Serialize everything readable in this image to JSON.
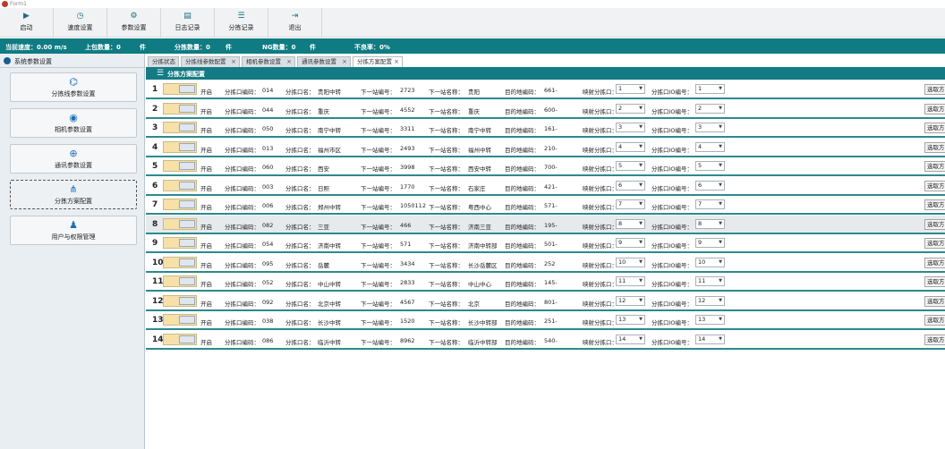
{
  "window": {
    "title": "Form1"
  },
  "toolbar": [
    {
      "label": "启动",
      "icon": "play-icon"
    },
    {
      "label": "速度设置",
      "icon": "speed-icon"
    },
    {
      "label": "参数设置",
      "icon": "settings-icon"
    },
    {
      "label": "日志记录",
      "icon": "printer-icon"
    },
    {
      "label": "分拣记录",
      "icon": "database-icon"
    },
    {
      "label": "退出",
      "icon": "exit-icon"
    }
  ],
  "status": {
    "speed_label": "当前速度：0.00  m/s",
    "upload_label": "上包数量：0",
    "upload_unit": "件",
    "sorted_label": "分拣数量：0",
    "sorted_unit": "件",
    "ng_label": "NG数量：0",
    "ng_unit": "件",
    "reject_label": "不良率：0%"
  },
  "sidebar": {
    "title": "系统参数设置",
    "items": [
      {
        "label": "分拣线参数设置",
        "icon": "network-icon"
      },
      {
        "label": "相机参数设置",
        "icon": "camera-icon"
      },
      {
        "label": "通讯参数设置",
        "icon": "globe-icon"
      },
      {
        "label": "分拣方案配置",
        "icon": "flow-icon"
      },
      {
        "label": "用户与权限管理",
        "icon": "users-icon"
      }
    ]
  },
  "tabs": [
    {
      "label": "分拣状态"
    },
    {
      "label": "分拣线参数配置"
    },
    {
      "label": "相机参数设置"
    },
    {
      "label": "通讯参数设置"
    },
    {
      "label": "分拣方案配置"
    }
  ],
  "panel": {
    "title": "分拣方案配置"
  },
  "row_labels": {
    "switch": "开启",
    "code": "分拣口编码：",
    "name": "分拣口名：",
    "next_code": "下一站编号：",
    "next_name": "下一站名称：",
    "dest": "目的地编码：",
    "map_port": "映射分拣口：",
    "io": "分拣口IO编号：",
    "fetch": "选取方"
  },
  "rows": [
    {
      "n": "1",
      "code": "014",
      "name": "贵阳中转",
      "next_code": "2723",
      "next_name": "贵阳",
      "dest": "661-",
      "map": "1",
      "io": "1"
    },
    {
      "n": "2",
      "code": "044",
      "name": "重庆",
      "next_code": "4552",
      "next_name": "重庆",
      "dest": "600-",
      "map": "2",
      "io": "2"
    },
    {
      "n": "3",
      "code": "050",
      "name": "南宁中转",
      "next_code": "3311",
      "next_name": "南宁中转",
      "dest": "161-",
      "map": "3",
      "io": "3"
    },
    {
      "n": "4",
      "code": "013",
      "name": "福州市区",
      "next_code": "2493",
      "next_name": "福州中转",
      "dest": "210-",
      "map": "4",
      "io": "4"
    },
    {
      "n": "5",
      "code": "060",
      "name": "西安",
      "next_code": "3998",
      "next_name": "西安中转",
      "dest": "700-",
      "map": "5",
      "io": "5"
    },
    {
      "n": "6",
      "code": "003",
      "name": "日照",
      "next_code": "1770",
      "next_name": "石家庄",
      "dest": "421-",
      "map": "6",
      "io": "6"
    },
    {
      "n": "7",
      "code": "006",
      "name": "郑州中转",
      "next_code": "1050112",
      "next_name": "粤西中心",
      "dest": "571-",
      "map": "7",
      "io": "7"
    },
    {
      "n": "8",
      "code": "082",
      "name": "三亚",
      "next_code": "466",
      "next_name": "济南三亚",
      "dest": "195-",
      "map": "8",
      "io": "8"
    },
    {
      "n": "9",
      "code": "054",
      "name": "济南中转",
      "next_code": "571",
      "next_name": "济南中转部",
      "dest": "501-",
      "map": "9",
      "io": "9"
    },
    {
      "n": "10",
      "code": "095",
      "name": "岳麓",
      "next_code": "3434",
      "next_name": "长沙岳麓区",
      "dest": "252",
      "map": "10",
      "io": "10"
    },
    {
      "n": "11",
      "code": "052",
      "name": "中山中转",
      "next_code": "2833",
      "next_name": "中山中心",
      "dest": "145-",
      "map": "11",
      "io": "11"
    },
    {
      "n": "12",
      "code": "092",
      "name": "北京中转",
      "next_code": "4567",
      "next_name": "北京",
      "dest": "801-",
      "map": "12",
      "io": "12"
    },
    {
      "n": "13",
      "code": "038",
      "name": "长沙中转",
      "next_code": "1520",
      "next_name": "长沙中转部",
      "dest": "251-",
      "map": "13",
      "io": "13"
    },
    {
      "n": "14",
      "code": "086",
      "name": "临沂中转",
      "next_code": "8962",
      "next_name": "临沂中转部",
      "dest": "540-",
      "map": "14",
      "io": "14"
    }
  ],
  "colors": {
    "accent": "#127b83",
    "row_border": "#2b8a8f",
    "switch_on": "#f7e1a9"
  }
}
